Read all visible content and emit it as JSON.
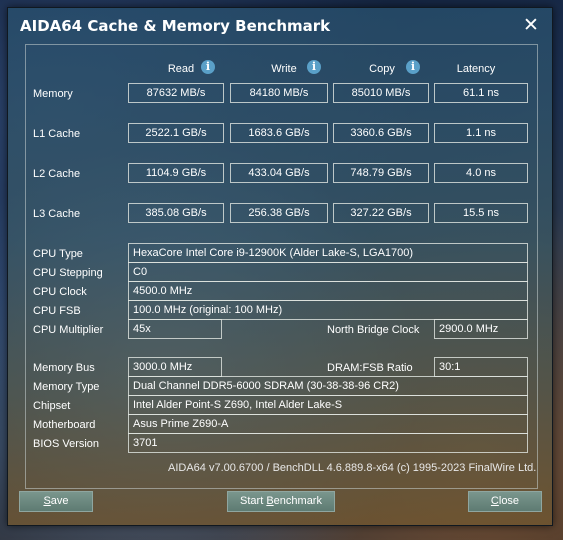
{
  "window": {
    "title": "AIDA64 Cache & Memory Benchmark",
    "close_glyph": "✕"
  },
  "columns": {
    "read": "Read",
    "write": "Write",
    "copy": "Copy",
    "latency": "Latency",
    "info_glyph": "i"
  },
  "rows": [
    {
      "label": "Memory",
      "read": "87632 MB/s",
      "write": "84180 MB/s",
      "copy": "85010 MB/s",
      "latency": "61.1 ns"
    },
    {
      "label": "L1 Cache",
      "read": "2522.1 GB/s",
      "write": "1683.6 GB/s",
      "copy": "3360.6 GB/s",
      "latency": "1.1 ns"
    },
    {
      "label": "L2 Cache",
      "read": "1104.9 GB/s",
      "write": "433.04 GB/s",
      "copy": "748.79 GB/s",
      "latency": "4.0 ns"
    },
    {
      "label": "L3 Cache",
      "read": "385.08 GB/s",
      "write": "256.38 GB/s",
      "copy": "327.22 GB/s",
      "latency": "15.5 ns"
    }
  ],
  "cpu": {
    "type_label": "CPU Type",
    "type": "HexaCore Intel Core i9-12900K  (Alder Lake-S, LGA1700)",
    "stepping_label": "CPU Stepping",
    "stepping": "C0",
    "clock_label": "CPU Clock",
    "clock": "4500.0 MHz",
    "fsb_label": "CPU FSB",
    "fsb": "100.0 MHz  (original: 100 MHz)",
    "multiplier_label": "CPU Multiplier",
    "multiplier": "45x",
    "nb_clock_label": "North Bridge Clock",
    "nb_clock": "2900.0 MHz"
  },
  "memory": {
    "bus_label": "Memory Bus",
    "bus": "3000.0 MHz",
    "ratio_label": "DRAM:FSB Ratio",
    "ratio": "30:1",
    "type_label": "Memory Type",
    "type": "Dual Channel DDR5-6000 SDRAM  (30-38-38-96 CR2)",
    "chipset_label": "Chipset",
    "chipset": "Intel Alder Point-S Z690, Intel Alder Lake-S",
    "motherboard_label": "Motherboard",
    "motherboard": "Asus Prime Z690-A",
    "bios_label": "BIOS Version",
    "bios": "3701"
  },
  "footer": "AIDA64 v7.00.6700 / BenchDLL 4.6.889.8-x64  (c) 1995-2023 FinalWire Ltd.",
  "buttons": {
    "save_first": "S",
    "save_rest": "ave",
    "start_pre": "Start ",
    "start_u": "B",
    "start_post": "enchmark",
    "close_first": "C",
    "close_rest": "lose"
  }
}
